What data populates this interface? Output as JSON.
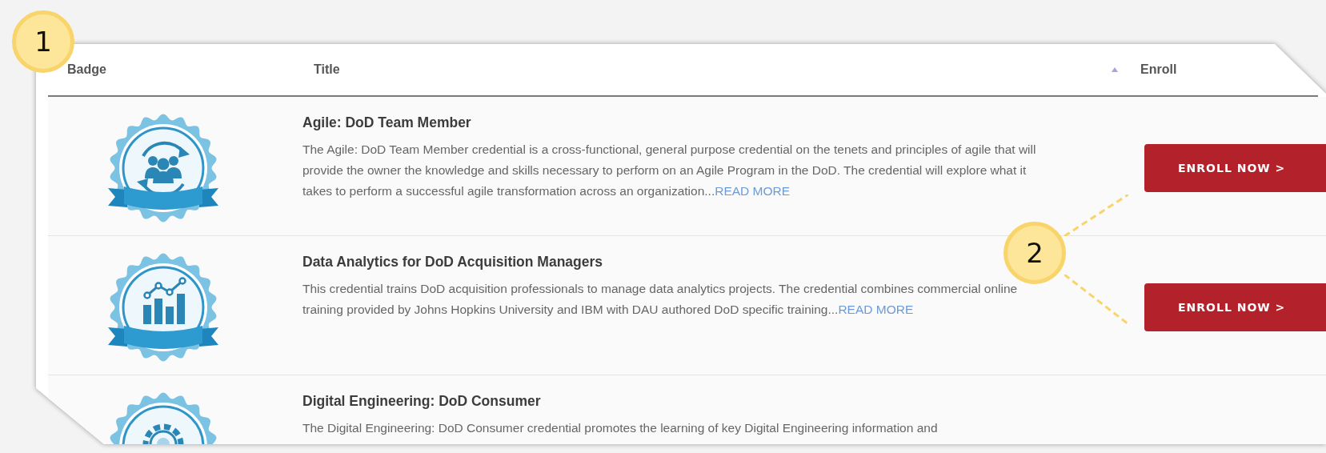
{
  "columns": [
    "Badge",
    "Title",
    "Enroll"
  ],
  "rows": [
    {
      "badge": {
        "kind": "people"
      },
      "title": "Agile: DoD Team Member",
      "description": "The Agile: DoD Team Member credential is a cross-functional, general purpose credential on the tenets and principles of agile that will provide the owner the knowledge and skills necessary to perform on an Agile Program in the DoD. The credential will explore what it takes to perform a successful agile transformation across an organization...",
      "read_more": "READ MORE",
      "enroll_button": "ENROLL NOW >"
    },
    {
      "badge": {
        "kind": "chart"
      },
      "title": "Data Analytics for DoD Acquisition Managers",
      "description": "This credential trains DoD acquisition professionals to manage data analytics projects. The credential combines commercial online training provided by Johns Hopkins University and IBM with DAU authored DoD specific training...",
      "read_more": "READ MORE",
      "enroll_button": "ENROLL NOW >"
    },
    {
      "badge": {
        "kind": "gear"
      },
      "title": "Digital Engineering: DoD Consumer",
      "description": "The Digital Engineering: DoD Consumer credential promotes the learning of key Digital Engineering information and"
    }
  ],
  "callouts": [
    {
      "number": "1"
    },
    {
      "number": "2"
    }
  ]
}
